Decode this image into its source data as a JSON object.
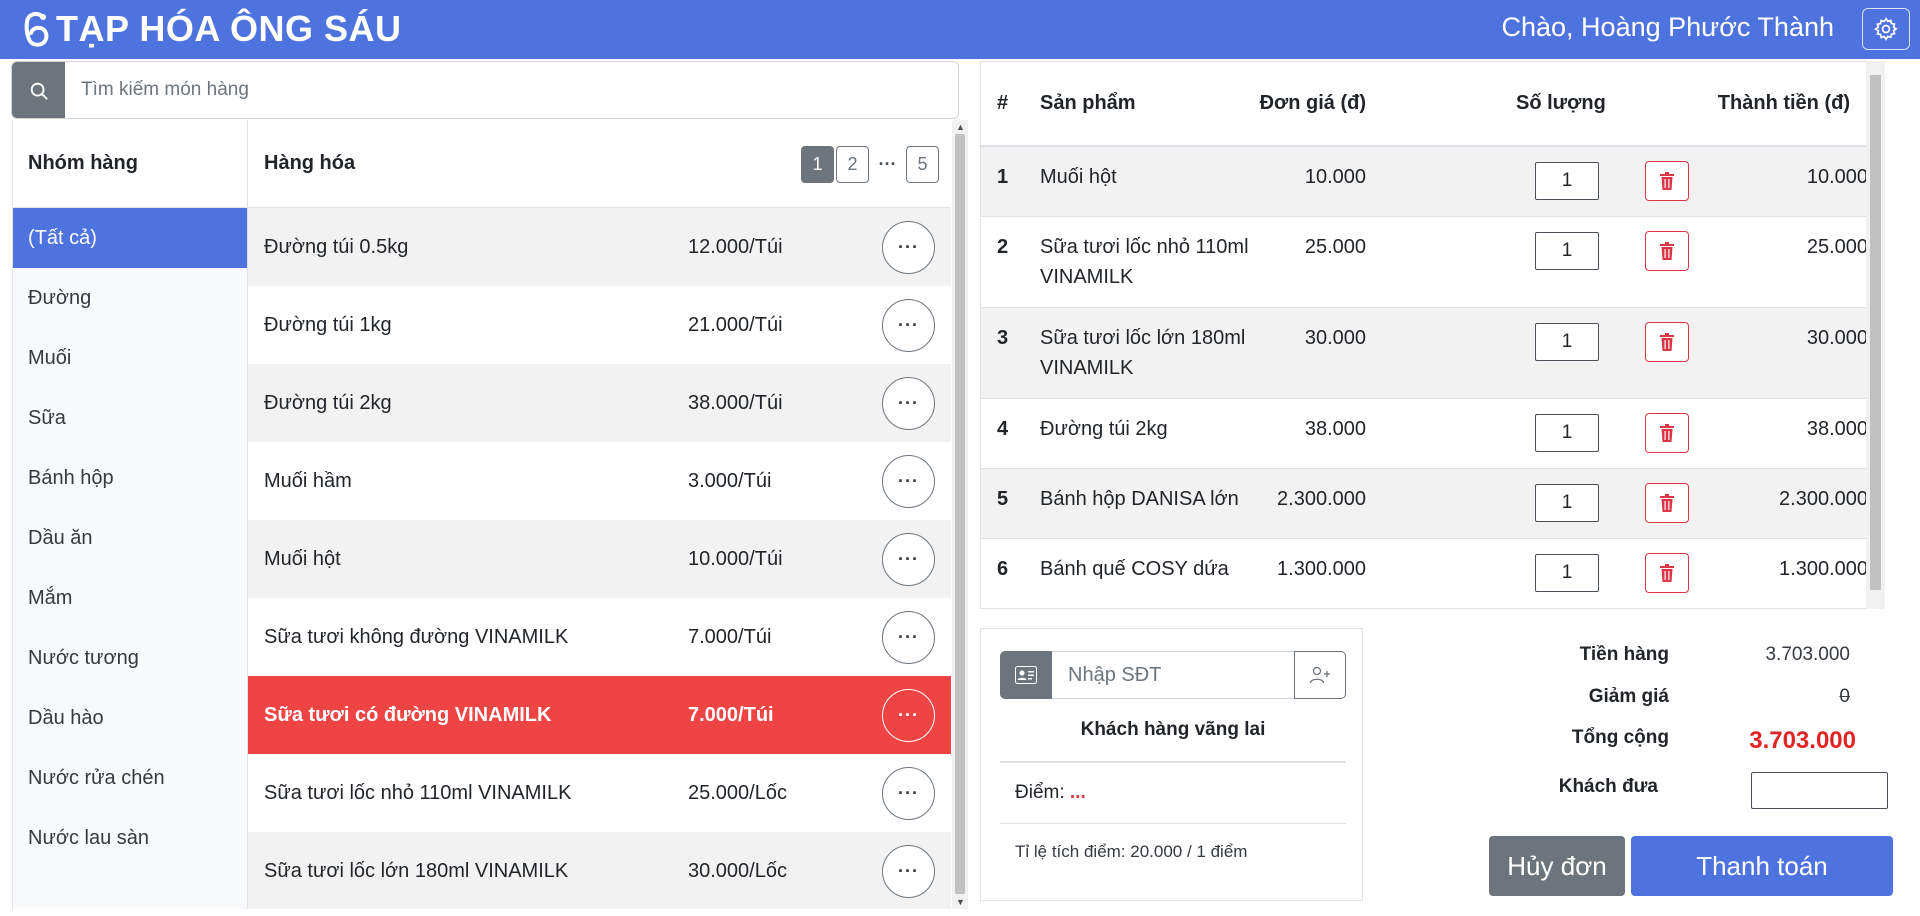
{
  "header": {
    "title": "TẠP HÓA ÔNG SÁU",
    "greeting": "Chào, Hoàng Phước Thành",
    "logo_icon": "shop-logo-icon",
    "settings_icon": "gear-icon",
    "color": "#4e73df"
  },
  "search": {
    "placeholder": "Tìm kiếm món hàng",
    "value": ""
  },
  "categories": {
    "heading": "Nhóm hàng",
    "items": [
      {
        "label": "(Tất cả)",
        "active": true
      },
      {
        "label": "Đường"
      },
      {
        "label": "Muối"
      },
      {
        "label": "Sữa"
      },
      {
        "label": "Bánh hộp"
      },
      {
        "label": "Dầu ăn"
      },
      {
        "label": "Mắm"
      },
      {
        "label": "Nước tương"
      },
      {
        "label": "Dầu hào"
      },
      {
        "label": "Nước rửa chén"
      },
      {
        "label": "Nước lau sàn"
      }
    ]
  },
  "products": {
    "heading": "Hàng hóa",
    "pages": [
      "1",
      "2",
      "...",
      "5"
    ],
    "current_page": "1",
    "rows": [
      {
        "name": "Đường túi 0.5kg",
        "price": "12.000/Túi"
      },
      {
        "name": "Đường túi 1kg",
        "price": "21.000/Túi"
      },
      {
        "name": "Đường túi 2kg",
        "price": "38.000/Túi"
      },
      {
        "name": "Muối hầm",
        "price": "3.000/Túi"
      },
      {
        "name": "Muối hột",
        "price": "10.000/Túi"
      },
      {
        "name": "Sữa tươi không đường VINAMILK",
        "price": "7.000/Túi"
      },
      {
        "name": "Sữa tươi có đường VINAMILK",
        "price": "7.000/Túi",
        "selected": true
      },
      {
        "name": "Sữa tươi lốc nhỏ 110ml VINAMILK",
        "price": "25.000/Lốc"
      },
      {
        "name": "Sữa tươi lốc lớn 180ml VINAMILK",
        "price": "30.000/Lốc"
      }
    ],
    "selected_color": "#ef4444"
  },
  "cart": {
    "columns": {
      "idx": "#",
      "name": "Sản phẩm",
      "price": "Đơn giá (đ)",
      "qty": "Số lượng",
      "total": "Thành tiền (đ)"
    },
    "rows": [
      {
        "idx": "1",
        "name": "Muối hột",
        "price": "10.000",
        "qty": "1",
        "total": "10.000"
      },
      {
        "idx": "2",
        "name": "Sữa tươi lốc nhỏ 110ml VINAMILK",
        "price": "25.000",
        "qty": "1",
        "total": "25.000"
      },
      {
        "idx": "3",
        "name": "Sữa tươi lốc lớn 180ml VINAMILK",
        "price": "30.000",
        "qty": "1",
        "total": "30.000"
      },
      {
        "idx": "4",
        "name": "Đường túi 2kg",
        "price": "38.000",
        "qty": "1",
        "total": "38.000"
      },
      {
        "idx": "5",
        "name": "Bánh hộp DANISA lớn",
        "price": "2.300.000",
        "qty": "1",
        "total": "2.300.000"
      },
      {
        "idx": "6",
        "name": "Bánh quế COSY dứa",
        "price": "1.300.000",
        "qty": "1",
        "total": "1.300.000"
      }
    ]
  },
  "customer": {
    "phone_placeholder": "Nhập SĐT",
    "phone_value": "",
    "name": "Khách hàng vãng lai",
    "points_label": "Điểm: ",
    "points_value": "...",
    "rate": "Tỉ lệ tích điểm: 20.000 / 1 điểm"
  },
  "totals": {
    "subtotal_label": "Tiền hàng",
    "subtotal": "3.703.000",
    "discount_label": "Giảm giá",
    "discount": "0",
    "grand_label": "Tổng cộng",
    "grand": "3.703.000",
    "paid_label": "Khách đưa",
    "paid_value": "",
    "cancel_label": "Hủy đơn",
    "pay_label": "Thanh toán"
  }
}
